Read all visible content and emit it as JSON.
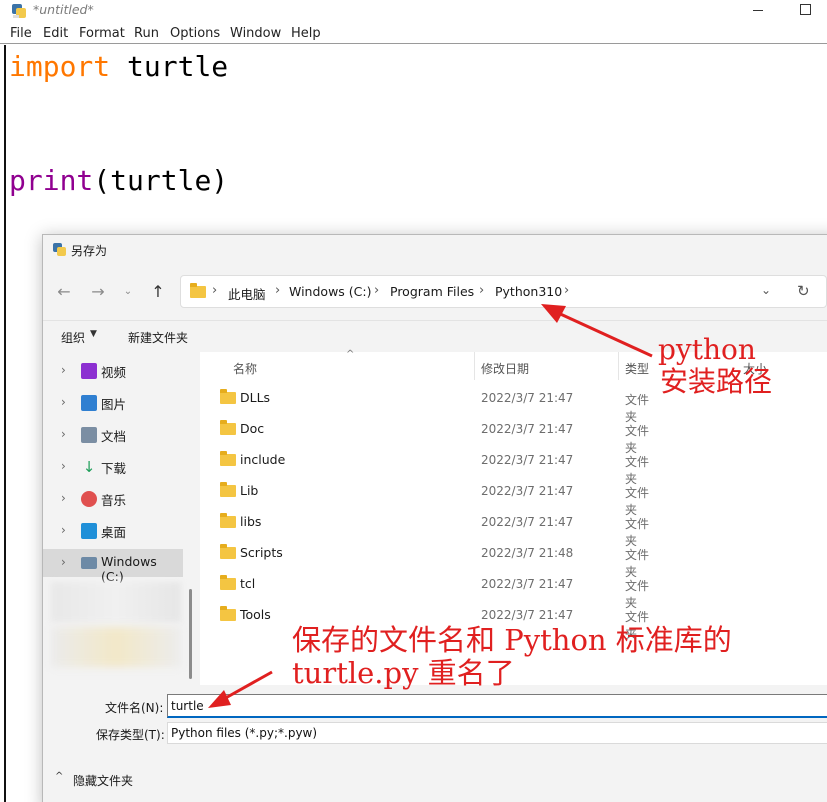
{
  "idle": {
    "title": "*untitled*",
    "menu": [
      "File",
      "Edit",
      "Format",
      "Run",
      "Options",
      "Window",
      "Help"
    ],
    "code": {
      "line1_kw": "import",
      "line1_rest": " turtle",
      "line2_fn": "print",
      "line2_rest": "(turtle)"
    }
  },
  "dialog": {
    "title": "另存为",
    "breadcrumb": [
      "此电脑",
      "Windows (C:)",
      "Program Files",
      "Python310"
    ],
    "commands": {
      "organize": "组织",
      "new_folder": "新建文件夹"
    },
    "nav_items": [
      "视频",
      "图片",
      "文档",
      "下载",
      "音乐",
      "桌面",
      "Windows (C:)"
    ],
    "columns": {
      "name": "名称",
      "date": "修改日期",
      "type": "类型",
      "size": "大小"
    },
    "files": [
      {
        "name": "DLLs",
        "date": "2022/3/7 21:47",
        "type": "文件夹"
      },
      {
        "name": "Doc",
        "date": "2022/3/7 21:47",
        "type": "文件夹"
      },
      {
        "name": "include",
        "date": "2022/3/7 21:47",
        "type": "文件夹"
      },
      {
        "name": "Lib",
        "date": "2022/3/7 21:47",
        "type": "文件夹"
      },
      {
        "name": "libs",
        "date": "2022/3/7 21:47",
        "type": "文件夹"
      },
      {
        "name": "Scripts",
        "date": "2022/3/7 21:48",
        "type": "文件夹"
      },
      {
        "name": "tcl",
        "date": "2022/3/7 21:47",
        "type": "文件夹"
      },
      {
        "name": "Tools",
        "date": "2022/3/7 21:47",
        "type": "文件夹"
      }
    ],
    "filename_label": "文件名(N):",
    "filename_value": "turtle",
    "filetype_label": "保存类型(T):",
    "filetype_value": "Python files (*.py;*.pyw)",
    "hide_folders": "隐藏文件夹"
  },
  "annotations": {
    "install_path_l1": "python",
    "install_path_l2": "安装路径",
    "conflict_l1": "保存的文件名和 Python 标准库的",
    "conflict_l2": "turtle.py 重名了"
  },
  "colors": {
    "keyword": "#ff7700",
    "builtin": "#900090",
    "annotation": "#e02020",
    "accent": "#0067c0"
  }
}
